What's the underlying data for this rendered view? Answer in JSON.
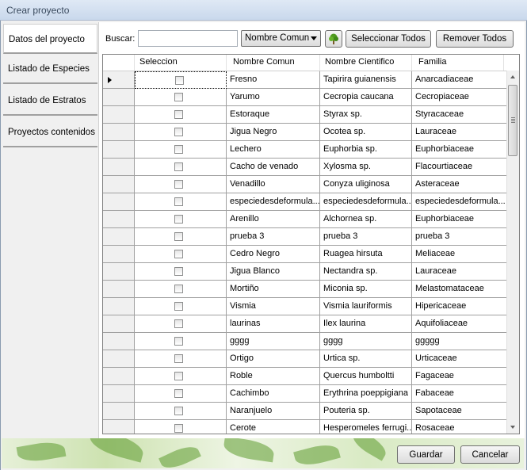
{
  "window": {
    "title": "Crear proyecto"
  },
  "sidebar": {
    "tabs": [
      {
        "label": "Datos del proyecto"
      },
      {
        "label": "Listado de Especies"
      },
      {
        "label": "Listado de Estratos"
      },
      {
        "label": "Proyectos contenidos"
      }
    ]
  },
  "toolbar": {
    "search_label": "Buscar:",
    "search_value": "",
    "filter_selected": "Nombre Comun",
    "select_all_label": "Seleccionar Todos",
    "remove_all_label": "Remover Todos",
    "tree_icon": "tree-icon"
  },
  "table": {
    "columns": [
      "Seleccion",
      "Nombre Comun",
      "Nombre Cientifico",
      "Familia"
    ],
    "rows": [
      {
        "comun": "Fresno",
        "cientifico": "Tapirira guianensis",
        "familia": "Anarcadiaceae"
      },
      {
        "comun": "Yarumo",
        "cientifico": "Cecropia caucana",
        "familia": "Cecropiaceae"
      },
      {
        "comun": "Estoraque",
        "cientifico": "Styrax sp.",
        "familia": "Styracaceae"
      },
      {
        "comun": "Jigua Negro",
        "cientifico": "Ocotea sp.",
        "familia": "Lauraceae"
      },
      {
        "comun": "Lechero",
        "cientifico": "Euphorbia sp.",
        "familia": "Euphorbiaceae"
      },
      {
        "comun": "Cacho de venado",
        "cientifico": "Xylosma sp.",
        "familia": "Flacourtiaceae"
      },
      {
        "comun": "Venadillo",
        "cientifico": "Conyza uliginosa",
        "familia": "Asteraceae"
      },
      {
        "comun": "especiedesdeformula...",
        "cientifico": "especiedesdeformula...",
        "familia": "especiedesdeformula..."
      },
      {
        "comun": "Arenillo",
        "cientifico": "Alchornea sp.",
        "familia": "Euphorbiaceae"
      },
      {
        "comun": "prueba 3",
        "cientifico": "prueba 3",
        "familia": "prueba 3"
      },
      {
        "comun": "Cedro Negro",
        "cientifico": "Ruagea hirsuta",
        "familia": "Meliaceae"
      },
      {
        "comun": "Jigua Blanco",
        "cientifico": "Nectandra sp.",
        "familia": "Lauraceae"
      },
      {
        "comun": "Mortiño",
        "cientifico": "Miconia sp.",
        "familia": "Melastomataceae"
      },
      {
        "comun": "Vismia",
        "cientifico": "Vismia lauriformis",
        "familia": "Hipericaceae"
      },
      {
        "comun": "laurinas",
        "cientifico": "Ilex laurina",
        "familia": "Aquifoliaceae"
      },
      {
        "comun": "gggg",
        "cientifico": "gggg",
        "familia": "ggggg"
      },
      {
        "comun": "Ortigo",
        "cientifico": "Urtica sp.",
        "familia": "Urticaceae"
      },
      {
        "comun": "Roble",
        "cientifico": "Quercus humboltti",
        "familia": "Fagaceae"
      },
      {
        "comun": "Cachimbo",
        "cientifico": "Erythrina poeppigiana",
        "familia": "Fabaceae"
      },
      {
        "comun": "Naranjuelo",
        "cientifico": "Pouteria sp.",
        "familia": "Sapotaceae"
      },
      {
        "comun": "Cerote",
        "cientifico": "Hesperomeles ferrugi...",
        "familia": "Rosaceae"
      }
    ]
  },
  "footer": {
    "save_label": "Guardar",
    "cancel_label": "Cancelar"
  }
}
